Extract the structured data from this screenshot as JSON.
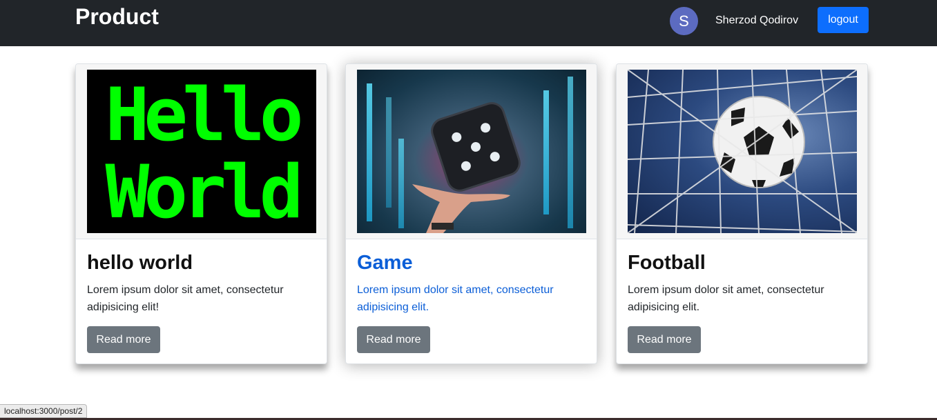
{
  "navbar": {
    "brand": "Product",
    "avatar_letter": "S",
    "username": "Sherzod Qodirov",
    "logout_label": "logout"
  },
  "cards": [
    {
      "image_text": "Hello World",
      "image_line1": "Hello",
      "image_line2": "World",
      "title": "hello world",
      "text": "Lorem ipsum dolor sit amet, consectetur adipisicing elit!",
      "button": "Read more"
    },
    {
      "image_icon": "dice-icon",
      "title": "Game",
      "text": "Lorem ipsum dolor sit amet, consectetur adipisicing elit.",
      "button": "Read more"
    },
    {
      "image_icon": "soccer-ball-icon",
      "title": "Football",
      "text": "Lorem ipsum dolor sit amet, consectetur adipisicing elit.",
      "button": "Read more"
    }
  ],
  "status_url": "localhost:3000/post/2",
  "colors": {
    "navbar": "#212529",
    "primary": "#0d6efd",
    "secondary": "#6c757d",
    "active_card_text": "#0b5ed7",
    "terminal_green": "#00ff00"
  }
}
